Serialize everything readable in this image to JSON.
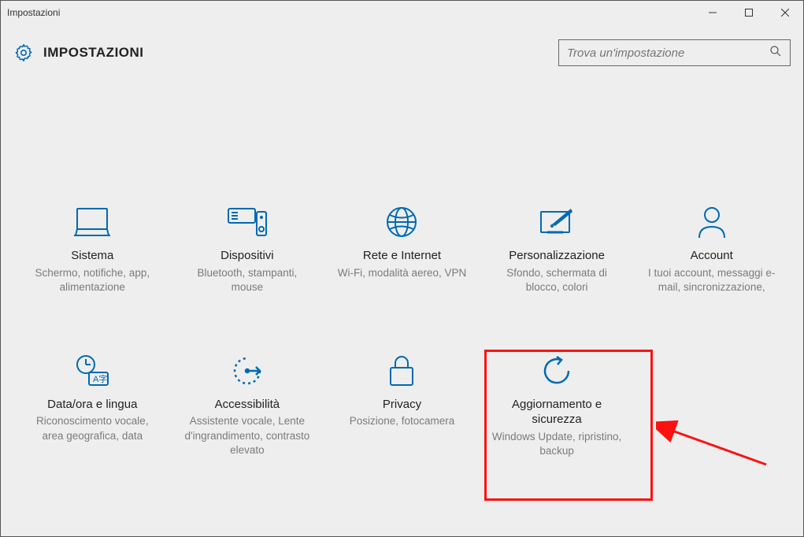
{
  "window": {
    "title": "Impostazioni"
  },
  "header": {
    "title": "IMPOSTAZIONI"
  },
  "search": {
    "placeholder": "Trova un'impostazione"
  },
  "tiles": [
    {
      "title": "Sistema",
      "desc": "Schermo, notifiche, app, alimentazione"
    },
    {
      "title": "Dispositivi",
      "desc": "Bluetooth, stampanti, mouse"
    },
    {
      "title": "Rete e Internet",
      "desc": "Wi-Fi, modalità aereo, VPN"
    },
    {
      "title": "Personalizzazione",
      "desc": "Sfondo, schermata di blocco, colori"
    },
    {
      "title": "Account",
      "desc": "I tuoi account, messaggi e-mail, sincronizzazione,"
    },
    {
      "title": "Data/ora e lingua",
      "desc": "Riconoscimento vocale, area geografica, data"
    },
    {
      "title": "Accessibilità",
      "desc": "Assistente vocale, Lente d'ingrandimento, contrasto elevato"
    },
    {
      "title": "Privacy",
      "desc": "Posizione, fotocamera"
    },
    {
      "title": "Aggiornamento e sicurezza",
      "desc": "Windows Update, ripristino, backup"
    }
  ],
  "colors": {
    "accent": "#0069b3",
    "highlight": "#fc1111"
  }
}
